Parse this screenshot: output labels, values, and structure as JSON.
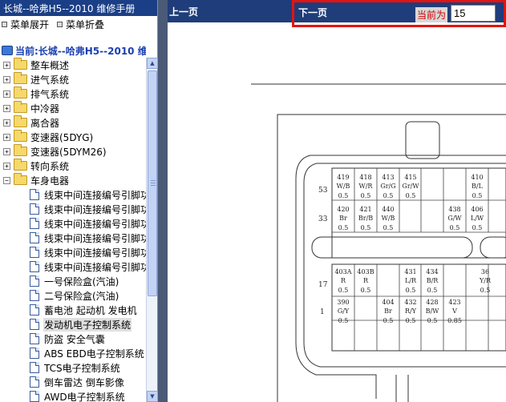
{
  "window": {
    "title": "长城--哈弗H5--2010 维修手册"
  },
  "menu": {
    "expand_label": "菜单展开",
    "collapse_label": "菜单折叠"
  },
  "tree": {
    "current_label": "当前:长城--哈弗H5--2010 维修手册",
    "folders_top": [
      {
        "label": "整车概述",
        "expander": "+"
      },
      {
        "label": "进气系统",
        "expander": "+"
      },
      {
        "label": "排气系统",
        "expander": "+"
      },
      {
        "label": "中冷器",
        "expander": "+"
      },
      {
        "label": "离合器",
        "expander": "+"
      },
      {
        "label": "变速器(5DYG)",
        "expander": "+"
      },
      {
        "label": "变速器(5DYM26)",
        "expander": "+"
      },
      {
        "label": "转向系统",
        "expander": "+"
      },
      {
        "label": "车身电器",
        "expander": "−"
      }
    ],
    "docs": [
      {
        "label": "线束中间连接编号引脚功能"
      },
      {
        "label": "线束中间连接编号引脚功能"
      },
      {
        "label": "线束中间连接编号引脚功能"
      },
      {
        "label": "线束中间连接编号引脚功能"
      },
      {
        "label": "线束中间连接编号引脚功能"
      },
      {
        "label": "线束中间连接编号引脚功能"
      },
      {
        "label": "一号保险盒(汽油)"
      },
      {
        "label": "二号保险盒(汽油)"
      },
      {
        "label": "蓄电池 起动机 发电机"
      },
      {
        "label": "发动机电子控制系统"
      },
      {
        "label": "防盗 安全气囊"
      },
      {
        "label": "ABS EBD电子控制系统"
      },
      {
        "label": "TCS电子控制系统"
      },
      {
        "label": "倒车雷达 倒车影像"
      },
      {
        "label": "AWD电子控制系统"
      }
    ]
  },
  "toolbar": {
    "prev_label": "上一页",
    "next_label": "下一页",
    "current_page_label": "当前为",
    "current_page_value": "15"
  },
  "diagram": {
    "row_numbers": [
      "53",
      "33",
      "17",
      "1"
    ],
    "row1": [
      {
        "num": "419",
        "wire": "W/B",
        "size": "0.5"
      },
      {
        "num": "418",
        "wire": "W/R",
        "size": "0.5"
      },
      {
        "num": "413",
        "wire": "Gr/G",
        "size": "0.5"
      },
      {
        "num": "415",
        "wire": "Gr/W",
        "size": "0.5"
      },
      {
        "num": "410",
        "wire": "B/L",
        "size": "0.5"
      }
    ],
    "row2": [
      {
        "num": "420",
        "wire": "Br",
        "size": "0.5"
      },
      {
        "num": "421",
        "wire": "Br/B",
        "size": "0.5"
      },
      {
        "num": "440",
        "wire": "W/B",
        "size": "0.5"
      },
      {
        "num": "438",
        "wire": "G/W",
        "size": "0.5"
      },
      {
        "num": "406",
        "wire": "L/W",
        "size": "0.5"
      }
    ],
    "row3": [
      {
        "num": "403A",
        "wire": "R",
        "size": "0.5"
      },
      {
        "num": "403B",
        "wire": "R",
        "size": "0.5"
      },
      {
        "num": "431",
        "wire": "L/R",
        "size": "0.5"
      },
      {
        "num": "434",
        "wire": "B/R",
        "size": "0.5"
      },
      {
        "num": "36",
        "wire": "Y/R",
        "size": "0.5"
      }
    ],
    "row4": [
      {
        "num": "390",
        "wire": "G/Y",
        "size": "0.5"
      },
      {
        "num": "404",
        "wire": "Br",
        "size": "0.5"
      },
      {
        "num": "432",
        "wire": "R/Y",
        "size": "0.5"
      },
      {
        "num": "428",
        "wire": "B/W",
        "size": "0.5"
      },
      {
        "num": "423",
        "wire": "V",
        "size": "0.85"
      }
    ]
  }
}
